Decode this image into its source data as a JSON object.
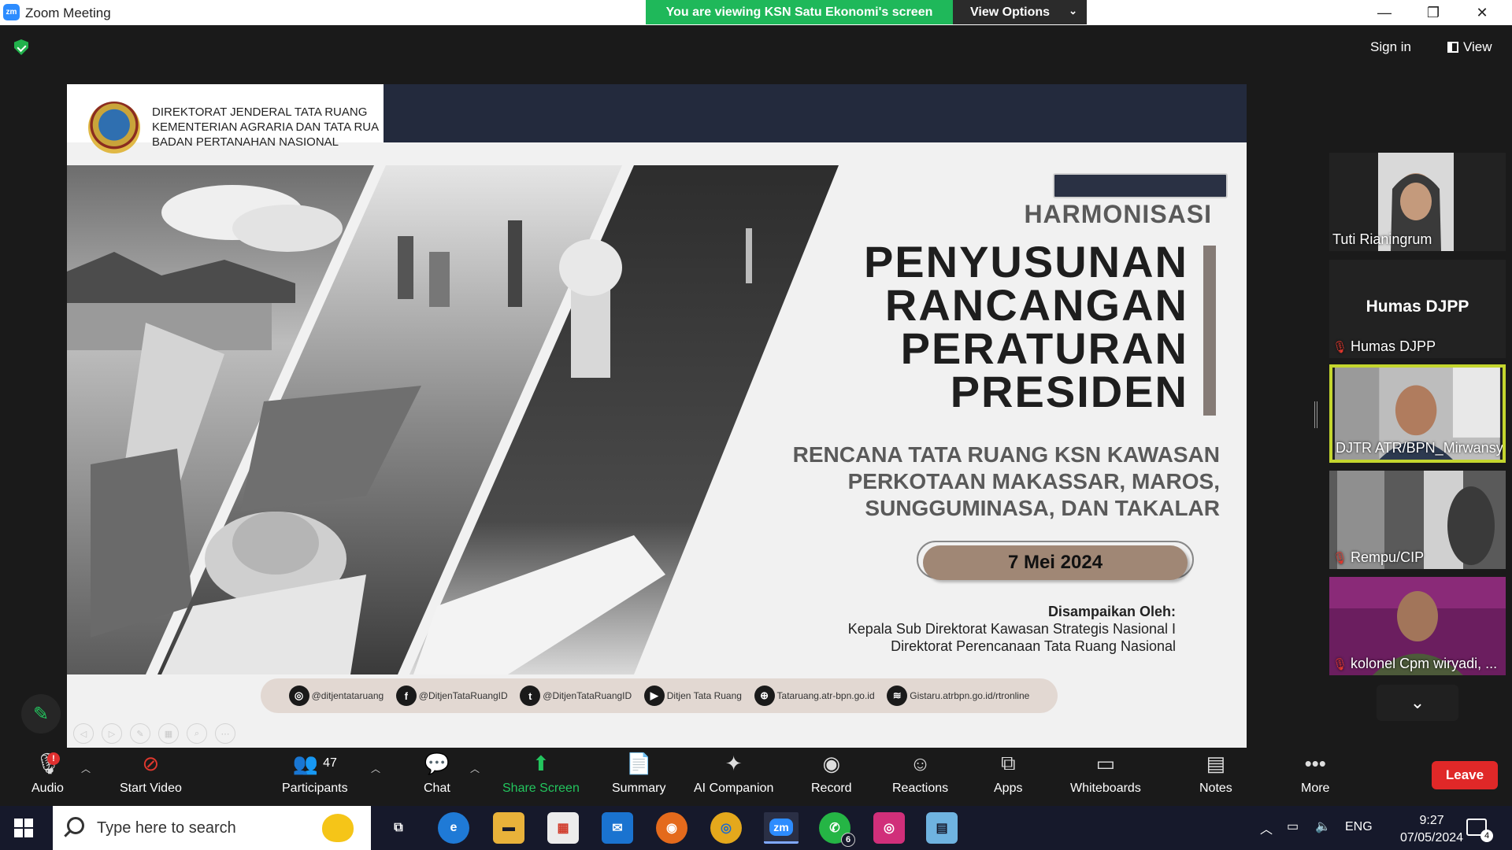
{
  "window": {
    "app_logo": "zm",
    "title": "Zoom Meeting",
    "banner": "You are viewing KSN Satu Ekonomi's screen",
    "view_options": "View Options",
    "controls": [
      "minimize-icon",
      "restore-icon",
      "close-icon"
    ]
  },
  "top_right": {
    "sign_in": "Sign in",
    "view": "View"
  },
  "slide": {
    "org_lines": [
      "DIREKTORAT JENDERAL TATA RUANG",
      "KEMENTERIAN AGRARIA DAN TATA RUA",
      "BADAN PERTANAHAN NASIONAL"
    ],
    "harmonisasi": "HARMONISASI",
    "title_lines": [
      "PENYUSUNAN",
      "RANCANGAN",
      "PERATURAN",
      "PRESIDEN"
    ],
    "subtitle_lines": [
      "RENCANA TATA RUANG KSN KAWASAN",
      "PERKOTAAN MAKASSAR, MAROS,",
      "SUNGGUMINASA, DAN TAKALAR"
    ],
    "date": "7 Mei 2024",
    "presented_by_label": "Disampaikan Oleh:",
    "presenter_lines": [
      "Kepala Sub Direktorat Kawasan Strategis Nasional I",
      "Direktorat Perencanaan Tata Ruang Nasional"
    ],
    "social": [
      {
        "icon": "instagram-icon",
        "glyph": "◎",
        "text": "@ditjentataruang"
      },
      {
        "icon": "facebook-icon",
        "glyph": "f",
        "text": "@DitjenTataRuangID"
      },
      {
        "icon": "twitter-icon",
        "glyph": "t",
        "text": "@DitjenTataRuangID"
      },
      {
        "icon": "youtube-icon",
        "glyph": "▶",
        "text": "Ditjen Tata Ruang"
      },
      {
        "icon": "globe-icon",
        "glyph": "⊕",
        "text": "Tataruang.atr-bpn.go.id"
      },
      {
        "icon": "layers-icon",
        "glyph": "≋",
        "text": "Gistaru.atrbpn.go.id/rtronline"
      }
    ]
  },
  "participants": [
    {
      "name": "Tuti Rianingrum",
      "muted": false
    },
    {
      "name": "Humas DJPP",
      "label": "Humas DJPP",
      "muted": true
    },
    {
      "name": "DJTR ATR/BPN_Mirwansy...",
      "muted": false,
      "active_speaker": true
    },
    {
      "name": "Rempu/CIP",
      "muted": true
    },
    {
      "name": "kolonel Cpm wiryadi, ...",
      "muted": true
    }
  ],
  "toolbar": {
    "audio": "Audio",
    "audio_badge": "!",
    "start_video": "Start Video",
    "participants": "Participants",
    "participants_count": "47",
    "chat": "Chat",
    "share_screen": "Share Screen",
    "summary": "Summary",
    "ai_companion": "AI Companion",
    "record": "Record",
    "reactions": "Reactions",
    "apps": "Apps",
    "whiteboards": "Whiteboards",
    "notes": "Notes",
    "more": "More",
    "leave": "Leave"
  },
  "taskbar": {
    "search_placeholder": "Type here to search",
    "apps": [
      {
        "icon": "task-view-icon",
        "glyph": "⧉"
      },
      {
        "icon": "edge-icon",
        "glyph": "e"
      },
      {
        "icon": "file-explorer-icon",
        "glyph": "▬"
      },
      {
        "icon": "store-icon",
        "glyph": "▦"
      },
      {
        "icon": "mail-icon",
        "glyph": "✉"
      },
      {
        "icon": "firefox-icon",
        "glyph": "◉"
      },
      {
        "icon": "chrome-icon",
        "glyph": "◎"
      },
      {
        "icon": "zoom-icon",
        "glyph": "zm"
      },
      {
        "icon": "whatsapp-icon",
        "glyph": "✆",
        "badge": "6"
      },
      {
        "icon": "instagram-icon",
        "glyph": "◎"
      },
      {
        "icon": "notes-app-icon",
        "glyph": "▤"
      }
    ],
    "language": "ENG",
    "time": "9:27",
    "date": "07/05/2024",
    "notifications": "4"
  },
  "colors": {
    "banner_green": "#1fb85a",
    "leave_red": "#e02828",
    "share_green": "#23c55e",
    "active_speaker_border": "#c4d62e",
    "slide_navy": "#232a3d",
    "date_pill": "#a08775"
  }
}
